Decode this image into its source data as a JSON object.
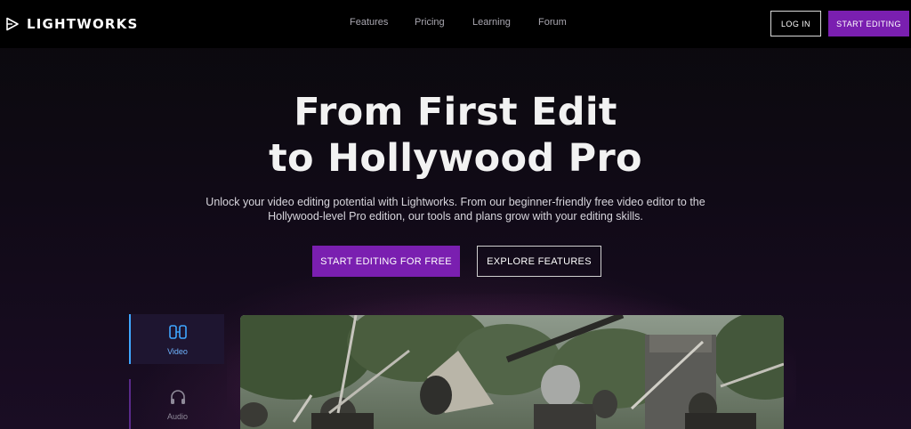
{
  "header": {
    "brand": "LIGHTWORKS",
    "nav": [
      "Features",
      "Pricing",
      "Learning",
      "Forum"
    ],
    "login_label": "LOG IN",
    "start_label": "START EDITING"
  },
  "hero": {
    "title_line1": "From First Edit",
    "title_line2": "to Hollywood Pro",
    "subtitle_line1": "Unlock your video editing potential with Lightworks. From our beginner-friendly free video editor to the",
    "subtitle_line2": "Hollywood-level Pro edition, our tools and plans grow with your editing skills.",
    "cta_primary": "START EDITING FOR FREE",
    "cta_secondary": "EXPLORE FEATURES"
  },
  "tabs": [
    {
      "label": "Video",
      "icon": "video-icon",
      "active": true
    },
    {
      "label": "Audio",
      "icon": "headphones-icon",
      "active": false
    }
  ],
  "colors": {
    "accent_purple": "#7a1fb0",
    "active_tab_blue": "#3fa6ff",
    "header_bg": "#000000"
  }
}
